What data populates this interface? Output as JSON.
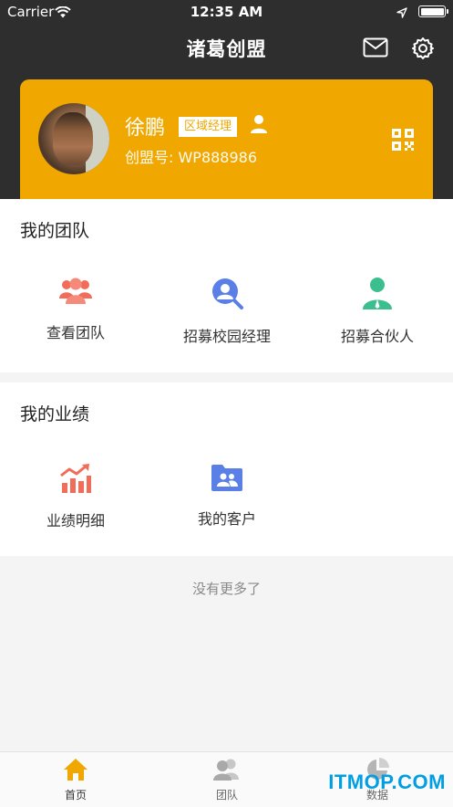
{
  "status_bar": {
    "carrier": "Carrier",
    "time": "12:35 AM",
    "battery_level": 1.0
  },
  "navbar": {
    "title": "诸葛创盟"
  },
  "profile": {
    "name": "徐鹏",
    "role_badge": "区域经理",
    "account_label": "创盟号: WP888986"
  },
  "team_section": {
    "title": "我的团队",
    "items": [
      {
        "label": "查看团队",
        "icon": "team-icon"
      },
      {
        "label": "招募校园经理",
        "icon": "search-user-icon"
      },
      {
        "label": "招募合伙人",
        "icon": "partner-icon"
      }
    ]
  },
  "performance_section": {
    "title": "我的业绩",
    "items": [
      {
        "label": "业绩明细",
        "icon": "chart-icon"
      },
      {
        "label": "我的客户",
        "icon": "customer-folder-icon"
      }
    ]
  },
  "no_more_text": "没有更多了",
  "tabbar": {
    "tabs": [
      {
        "label": "首页",
        "icon": "home-icon",
        "active": true
      },
      {
        "label": "团队",
        "icon": "team-tab-icon",
        "active": false
      },
      {
        "label": "数据",
        "icon": "pie-chart-icon",
        "active": false
      }
    ]
  },
  "watermark": "ITMOP.COM",
  "colors": {
    "accent": "#f0a800",
    "header_bg": "#2e2e2e",
    "tab_active": "#f0a800",
    "tab_inactive": "#9a9a9a"
  }
}
